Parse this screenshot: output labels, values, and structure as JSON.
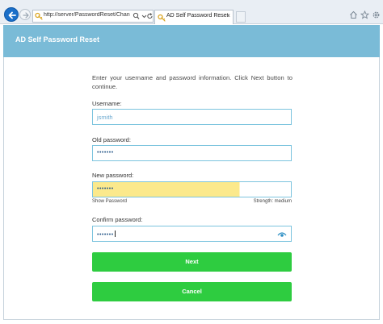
{
  "browser": {
    "url": "http://server/PasswordReset/ChangePass",
    "tab_title": "AD Self Password Reset",
    "tab_close": "×"
  },
  "page": {
    "title": "AD Self Password Reset",
    "intro": "Enter your username and password information. Click Next button to continue.",
    "username": {
      "label": "Username:",
      "value": "jsmith"
    },
    "old_password": {
      "label": "Old password:",
      "value": "•••••••"
    },
    "new_password": {
      "label": "New password:",
      "value": "•••••••",
      "show_label": "Show Password",
      "strength": "Strength: medium",
      "strength_fill": 0.74
    },
    "confirm_password": {
      "label": "Confirm password:",
      "value": "•••••••"
    },
    "next_label": "Next",
    "cancel_label": "Cancel"
  },
  "colors": {
    "header": "#7abbd7",
    "button": "#2ecc40",
    "field_border": "#7cc4de",
    "strength_fill": "#fbe98c"
  }
}
